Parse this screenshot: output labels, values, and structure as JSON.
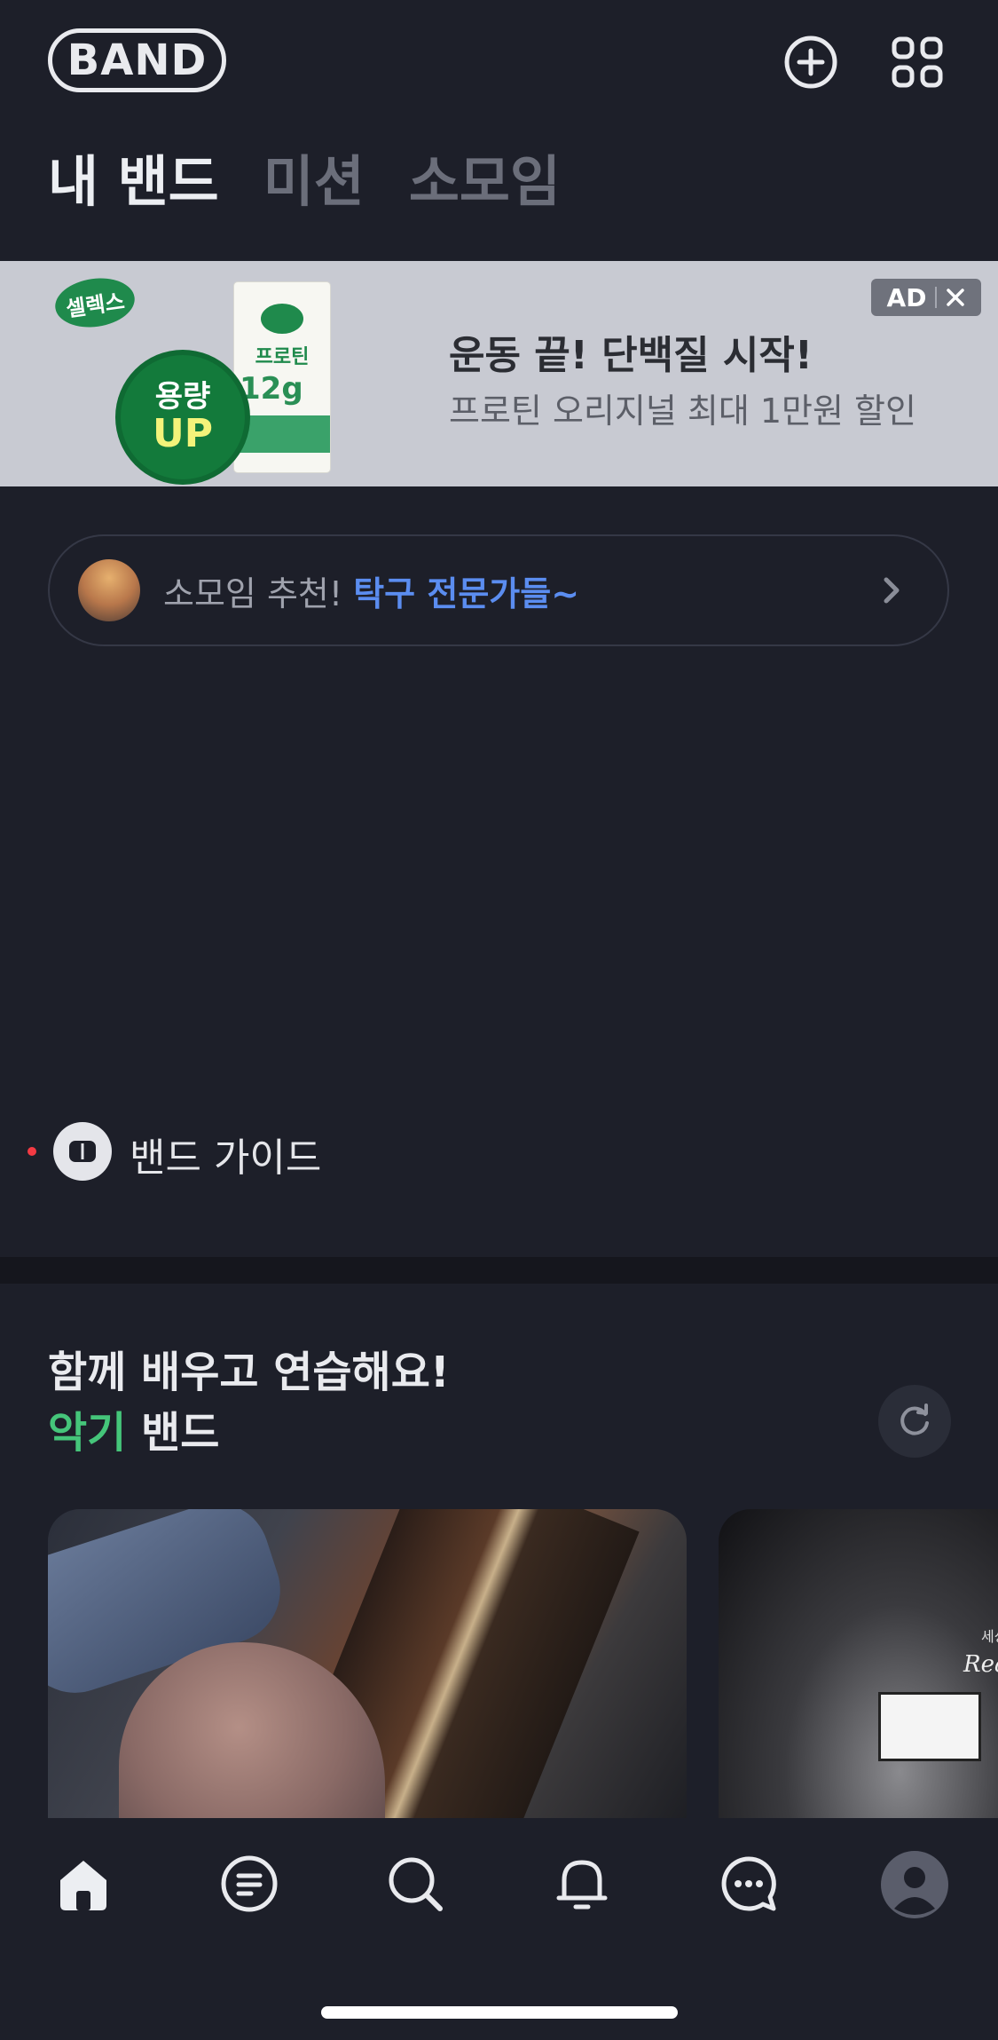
{
  "header": {
    "logo": "BAND",
    "tabs": [
      {
        "label": "내 밴드",
        "active": true
      },
      {
        "label": "미션",
        "active": false
      },
      {
        "label": "소모임",
        "active": false
      }
    ],
    "icons": [
      "add-circle-icon",
      "apps-grid-icon"
    ]
  },
  "ad": {
    "brand": "셀렉스",
    "badge_line1": "용량",
    "badge_line2": "UP",
    "pack_name": "프로틴",
    "pack_gram": "12g",
    "title": "운동 끝! 단백질 시작!",
    "subtitle": "프로틴 오리지널 최대 1만원 할인",
    "label": "AD"
  },
  "recommendation": {
    "prefix": "소모임 추천! ",
    "highlight": "탁구 전문가들~"
  },
  "guide": {
    "label": "밴드 가이드"
  },
  "section": {
    "title_line1": "함께 배우고 연습해요!",
    "title_accent": "악기",
    "title_rest": " 밴드"
  },
  "cards": {
    "card2_small": "세상",
    "card2_script": "Rea"
  },
  "bottom_nav": [
    "home-icon",
    "feed-icon",
    "search-icon",
    "bell-icon",
    "chat-icon",
    "profile-avatar"
  ],
  "colors": {
    "background": "#1d1f29",
    "accent_blue": "#5b8df0",
    "accent_green": "#45c57a",
    "notification_dot": "#f43a43"
  }
}
